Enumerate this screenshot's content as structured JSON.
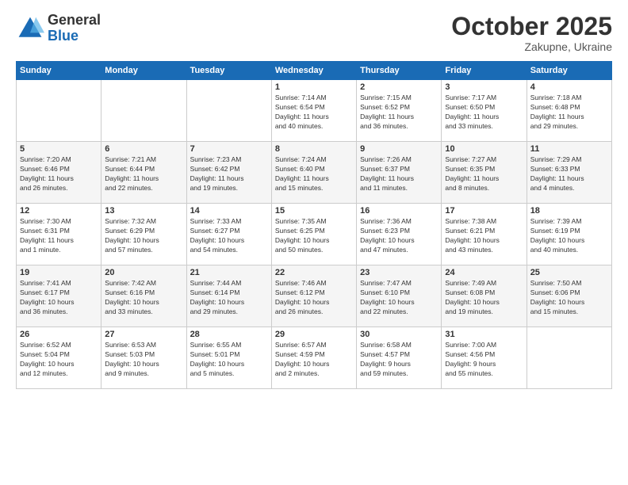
{
  "logo": {
    "general": "General",
    "blue": "Blue"
  },
  "header": {
    "month": "October 2025",
    "location": "Zakupne, Ukraine"
  },
  "days_of_week": [
    "Sunday",
    "Monday",
    "Tuesday",
    "Wednesday",
    "Thursday",
    "Friday",
    "Saturday"
  ],
  "weeks": [
    [
      {
        "day": "",
        "info": ""
      },
      {
        "day": "",
        "info": ""
      },
      {
        "day": "",
        "info": ""
      },
      {
        "day": "1",
        "info": "Sunrise: 7:14 AM\nSunset: 6:54 PM\nDaylight: 11 hours\nand 40 minutes."
      },
      {
        "day": "2",
        "info": "Sunrise: 7:15 AM\nSunset: 6:52 PM\nDaylight: 11 hours\nand 36 minutes."
      },
      {
        "day": "3",
        "info": "Sunrise: 7:17 AM\nSunset: 6:50 PM\nDaylight: 11 hours\nand 33 minutes."
      },
      {
        "day": "4",
        "info": "Sunrise: 7:18 AM\nSunset: 6:48 PM\nDaylight: 11 hours\nand 29 minutes."
      }
    ],
    [
      {
        "day": "5",
        "info": "Sunrise: 7:20 AM\nSunset: 6:46 PM\nDaylight: 11 hours\nand 26 minutes."
      },
      {
        "day": "6",
        "info": "Sunrise: 7:21 AM\nSunset: 6:44 PM\nDaylight: 11 hours\nand 22 minutes."
      },
      {
        "day": "7",
        "info": "Sunrise: 7:23 AM\nSunset: 6:42 PM\nDaylight: 11 hours\nand 19 minutes."
      },
      {
        "day": "8",
        "info": "Sunrise: 7:24 AM\nSunset: 6:40 PM\nDaylight: 11 hours\nand 15 minutes."
      },
      {
        "day": "9",
        "info": "Sunrise: 7:26 AM\nSunset: 6:37 PM\nDaylight: 11 hours\nand 11 minutes."
      },
      {
        "day": "10",
        "info": "Sunrise: 7:27 AM\nSunset: 6:35 PM\nDaylight: 11 hours\nand 8 minutes."
      },
      {
        "day": "11",
        "info": "Sunrise: 7:29 AM\nSunset: 6:33 PM\nDaylight: 11 hours\nand 4 minutes."
      }
    ],
    [
      {
        "day": "12",
        "info": "Sunrise: 7:30 AM\nSunset: 6:31 PM\nDaylight: 11 hours\nand 1 minute."
      },
      {
        "day": "13",
        "info": "Sunrise: 7:32 AM\nSunset: 6:29 PM\nDaylight: 10 hours\nand 57 minutes."
      },
      {
        "day": "14",
        "info": "Sunrise: 7:33 AM\nSunset: 6:27 PM\nDaylight: 10 hours\nand 54 minutes."
      },
      {
        "day": "15",
        "info": "Sunrise: 7:35 AM\nSunset: 6:25 PM\nDaylight: 10 hours\nand 50 minutes."
      },
      {
        "day": "16",
        "info": "Sunrise: 7:36 AM\nSunset: 6:23 PM\nDaylight: 10 hours\nand 47 minutes."
      },
      {
        "day": "17",
        "info": "Sunrise: 7:38 AM\nSunset: 6:21 PM\nDaylight: 10 hours\nand 43 minutes."
      },
      {
        "day": "18",
        "info": "Sunrise: 7:39 AM\nSunset: 6:19 PM\nDaylight: 10 hours\nand 40 minutes."
      }
    ],
    [
      {
        "day": "19",
        "info": "Sunrise: 7:41 AM\nSunset: 6:17 PM\nDaylight: 10 hours\nand 36 minutes."
      },
      {
        "day": "20",
        "info": "Sunrise: 7:42 AM\nSunset: 6:16 PM\nDaylight: 10 hours\nand 33 minutes."
      },
      {
        "day": "21",
        "info": "Sunrise: 7:44 AM\nSunset: 6:14 PM\nDaylight: 10 hours\nand 29 minutes."
      },
      {
        "day": "22",
        "info": "Sunrise: 7:46 AM\nSunset: 6:12 PM\nDaylight: 10 hours\nand 26 minutes."
      },
      {
        "day": "23",
        "info": "Sunrise: 7:47 AM\nSunset: 6:10 PM\nDaylight: 10 hours\nand 22 minutes."
      },
      {
        "day": "24",
        "info": "Sunrise: 7:49 AM\nSunset: 6:08 PM\nDaylight: 10 hours\nand 19 minutes."
      },
      {
        "day": "25",
        "info": "Sunrise: 7:50 AM\nSunset: 6:06 PM\nDaylight: 10 hours\nand 15 minutes."
      }
    ],
    [
      {
        "day": "26",
        "info": "Sunrise: 6:52 AM\nSunset: 5:04 PM\nDaylight: 10 hours\nand 12 minutes."
      },
      {
        "day": "27",
        "info": "Sunrise: 6:53 AM\nSunset: 5:03 PM\nDaylight: 10 hours\nand 9 minutes."
      },
      {
        "day": "28",
        "info": "Sunrise: 6:55 AM\nSunset: 5:01 PM\nDaylight: 10 hours\nand 5 minutes."
      },
      {
        "day": "29",
        "info": "Sunrise: 6:57 AM\nSunset: 4:59 PM\nDaylight: 10 hours\nand 2 minutes."
      },
      {
        "day": "30",
        "info": "Sunrise: 6:58 AM\nSunset: 4:57 PM\nDaylight: 9 hours\nand 59 minutes."
      },
      {
        "day": "31",
        "info": "Sunrise: 7:00 AM\nSunset: 4:56 PM\nDaylight: 9 hours\nand 55 minutes."
      },
      {
        "day": "",
        "info": ""
      }
    ]
  ]
}
